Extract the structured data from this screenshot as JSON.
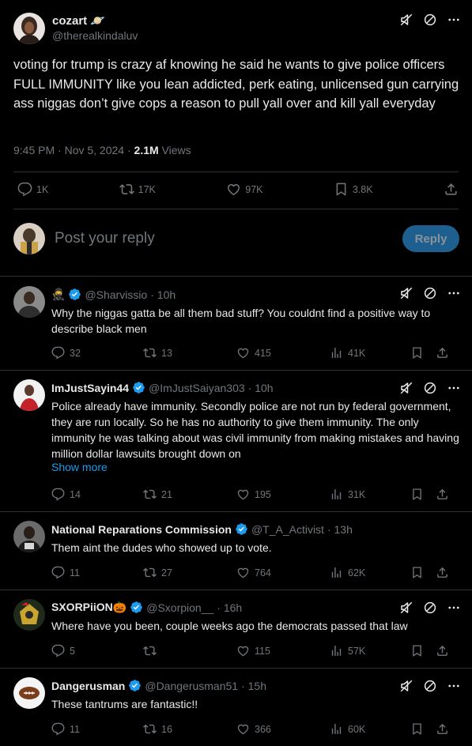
{
  "main": {
    "name": "cozart 🪐",
    "handle": "@therealkindaluv",
    "text": "voting for trump is crazy af knowing he said he wants to give police officers FULL IMMUNITY like you lean addicted, perk eating, unlicensed gun carrying ass niggas don’t give cops a reason to pull yall over and kill yall everyday",
    "time": "9:45 PM · Nov 5, 2024 · ",
    "views_count": "2.1M",
    "views_label": " Views",
    "replies": "1K",
    "retweets": "17K",
    "likes": "97K",
    "bookmarks": "3.8K"
  },
  "reply_box": {
    "placeholder": "Post your reply",
    "button": "Reply"
  },
  "replies": [
    {
      "name": "🥷",
      "handle": "@Sharvissio",
      "time": "· 10h",
      "text": "Why the niggas gatta be all them bad stuff? You couldnt find a positive way to describe black men",
      "replies": "32",
      "retweets": "13",
      "likes": "415",
      "views": "41K"
    },
    {
      "name": "ImJustSayin44",
      "handle": "@ImJustSaiyan303",
      "time": "· 10h",
      "text": "Police already have immunity. Secondly police are not run by federal government, they are run locally. So he has no authority to give them immunity. The only immunity he was talking about was civil immunity from making mistakes and having million dollar lawsuits brought down on",
      "show_more": "Show more",
      "replies": "14",
      "retweets": "21",
      "likes": "195",
      "views": "31K"
    },
    {
      "name": "National Reparations Commission",
      "handle": "@T_A_Activist",
      "time": "· 13h",
      "text": "Them aint the dudes who showed up to vote.",
      "replies": "11",
      "retweets": "27",
      "likes": "764",
      "views": "62K"
    },
    {
      "name": "SXORPiiON🎃",
      "handle": "@Sxorpion__",
      "time": "· 16h",
      "text": "Where have you been, couple weeks ago the democrats passed that law",
      "replies": "5",
      "retweets": "",
      "likes": "115",
      "views": "57K"
    },
    {
      "name": "Dangerusman",
      "handle": "@Dangerusman51",
      "time": "· 15h",
      "text": "These tantrums are fantastic!!",
      "replies": "11",
      "retweets": "16",
      "likes": "366",
      "views": "60K"
    }
  ],
  "colors": {
    "background": "#000000",
    "text": "#e7e9ea",
    "muted": "#71767b",
    "link": "#1d9bf0",
    "verified": "#1d9bf0",
    "reply_button": "#1d5f8e"
  },
  "icons": [
    "mute-icon",
    "block-icon",
    "more-icon",
    "reply-icon",
    "retweet-icon",
    "like-icon",
    "views-icon",
    "bookmark-icon",
    "share-icon",
    "verified-icon"
  ]
}
